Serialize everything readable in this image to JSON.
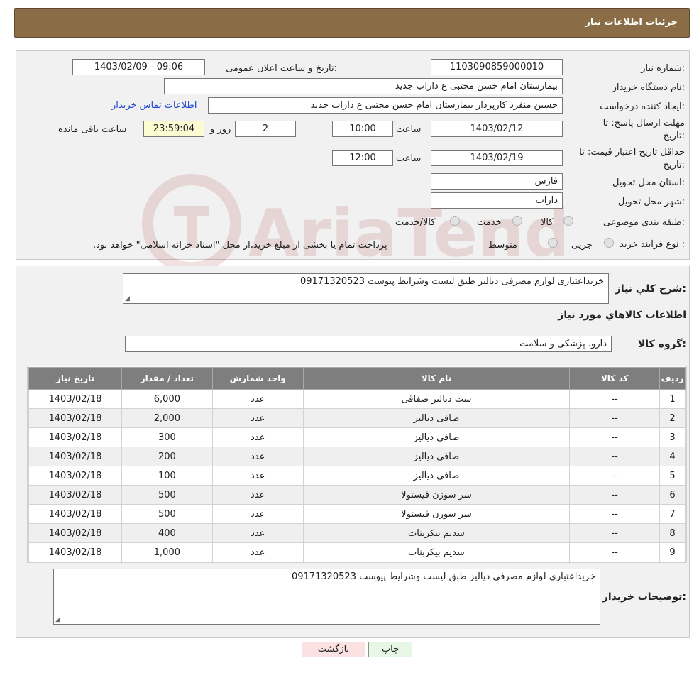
{
  "header": {
    "title": "جزئیات اطلاعات نیاز"
  },
  "fields": {
    "need_number_label": "شماره نیاز:",
    "need_number": "1103090859000010",
    "announce_label": "تاریخ و ساعت اعلان عمومی:",
    "announce_value": "1403/02/09 - 09:06",
    "buyer_label": "نام دستگاه خریدار:",
    "buyer_value": "بیمارستان امام حسن مجتبی  ع  داراب جدید",
    "creator_label": "ایجاد کننده درخواست:",
    "creator_value": "حسین  منفرد کارپرداز بیمارستان امام حسن مجتبی  ع  داراب جدید",
    "contact_link": "اطلاعات تماس خریدار",
    "deadline_label_1": "مهلت ارسال پاسخ: تا",
    "deadline_label_2": "تاریخ:",
    "deadline_date": "1403/02/12",
    "hour_label": "ساعت",
    "deadline_time": "10:00",
    "days_value": "2",
    "days_label": "روز و",
    "remaining_time": "23:59:04",
    "remaining_label": "ساعت باقی مانده",
    "validity_label_1": "حداقل تاریخ اعتبار قیمت: تا",
    "validity_label_2": "تاریخ:",
    "validity_date": "1403/02/19",
    "validity_hour_label": "ساعت",
    "validity_time": "12:00",
    "province_label": "استان محل تحویل:",
    "province_value": "فارس",
    "city_label": "شهر محل تحویل:",
    "city_value": "داراب",
    "category_label": "طبقه بندی موضوعی:",
    "category_options": [
      "کالا",
      "خدمت",
      "کالا/خدمت"
    ],
    "process_label": "نوع فرآیند خرید :",
    "process_options": [
      "جزیی",
      "متوسط"
    ],
    "process_note": "پرداخت تمام یا بخشی از مبلغ خرید،از محل \"اسناد خزانه اسلامی\" خواهد بود."
  },
  "summary": {
    "label": "شرح کلي نياز:",
    "value": "خریداعتباری لوازم مصرفی دیالیز طبق لیست وشرایط پیوست 09171320523",
    "goods_info_title": "اطلاعات کالاهاي مورد نياز",
    "group_label": "گروه کالا:",
    "group_value": "دارو، پزشکی و سلامت"
  },
  "table": {
    "headers": [
      "ردیف",
      "کد کالا",
      "نام کالا",
      "واحد شمارش",
      "تعداد / مقدار",
      "تاریخ نیاز"
    ],
    "rows": [
      [
        "1",
        "--",
        "ست دیالیز صفاقی",
        "عدد",
        "6,000",
        "1403/02/18"
      ],
      [
        "2",
        "--",
        "صافی دیالیز",
        "عدد",
        "2,000",
        "1403/02/18"
      ],
      [
        "3",
        "--",
        "صافی دیالیز",
        "عدد",
        "300",
        "1403/02/18"
      ],
      [
        "4",
        "--",
        "صافی دیالیز",
        "عدد",
        "200",
        "1403/02/18"
      ],
      [
        "5",
        "--",
        "صافی دیالیز",
        "عدد",
        "100",
        "1403/02/18"
      ],
      [
        "6",
        "--",
        "سر سوزن فیستولا",
        "عدد",
        "500",
        "1403/02/18"
      ],
      [
        "7",
        "--",
        "سر سوزن فیستولا",
        "عدد",
        "500",
        "1403/02/18"
      ],
      [
        "8",
        "--",
        "سدیم بیکربنات",
        "عدد",
        "400",
        "1403/02/18"
      ],
      [
        "9",
        "--",
        "سدیم بیکربنات",
        "عدد",
        "1,000",
        "1403/02/18"
      ]
    ]
  },
  "buyer_notes": {
    "label": "توضیحات خریدار:",
    "value": "خریداعتباری لوازم مصرفی دیالیز طبق لیست وشرایط پیوست 09171320523"
  },
  "buttons": {
    "print": "چاپ",
    "back": "بازگشت"
  },
  "colors": {
    "header_bg": "#8a6d46",
    "panel_bg": "#f1f1f1",
    "table_header_bg": "#7e7e7e",
    "link": "#1a44d0",
    "print_btn_bg": "#e6f7e6",
    "back_btn_bg": "#fbe1e1"
  }
}
